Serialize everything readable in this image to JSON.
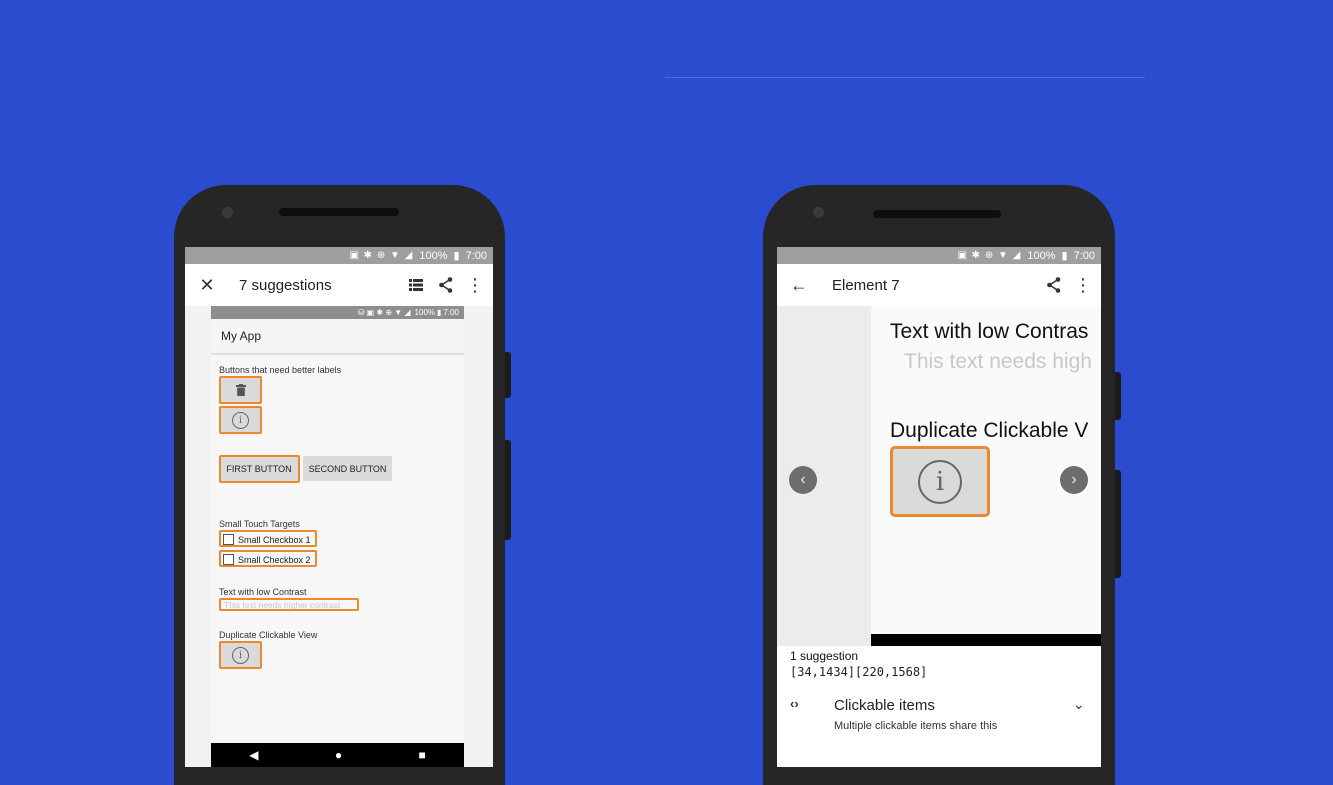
{
  "left_phone": {
    "status": {
      "battery": "100%",
      "time": "7:00"
    },
    "toolbar": {
      "title": "7 suggestions"
    },
    "inner_app": {
      "status": {
        "battery": "100%",
        "time": "7:00"
      },
      "title": "My App",
      "section_labels": "Buttons that need better labels",
      "first_button": "FIRST BUTTON",
      "second_button": "SECOND BUTTON",
      "section_touch": "Small Touch Targets",
      "checkbox1": "Small Checkbox 1",
      "checkbox2": "Small Checkbox 2",
      "section_contrast": "Text with low Contrast",
      "low_contrast_text": "This text needs higher contrast",
      "section_duplicate": "Duplicate Clickable View"
    }
  },
  "right_phone": {
    "status": {
      "battery": "100%",
      "time": "7:00"
    },
    "toolbar": {
      "title": "Element 7"
    },
    "detail": {
      "heading_contrast": "Text with low Contras",
      "low_contrast_text": "This text needs high",
      "heading_duplicate": "Duplicate Clickable V"
    },
    "suggestion": {
      "count": "1 suggestion",
      "bounds": "[34,1434][220,1568]",
      "item_title": "Clickable items",
      "item_desc": "Multiple clickable items share this"
    }
  },
  "colors": {
    "background": "#2b4ccf",
    "highlight": "#e98a2e"
  }
}
